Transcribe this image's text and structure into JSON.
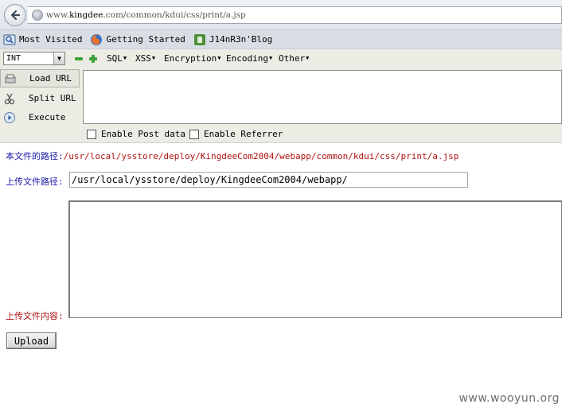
{
  "browser": {
    "url_prefix": "www.",
    "url_host": "kingdee.",
    "url_rest": "com/common/kdui/css/print/a.jsp"
  },
  "bookmarks": [
    {
      "label": "Most Visited",
      "icon": "most-visited-icon"
    },
    {
      "label": "Getting Started",
      "icon": "firefox-icon"
    },
    {
      "label": "J14nR3n'Blog",
      "icon": "evernote-icon"
    }
  ],
  "hackbar": {
    "type_select": "INT",
    "menus": [
      "SQL",
      "XSS",
      "Encryption",
      "Encoding",
      "Other"
    ],
    "load_url": "Load URL",
    "split_url": "Split URL",
    "execute": "Execute",
    "enable_post": "Enable Post data",
    "enable_referrer": "Enable Referrer",
    "url_value": ""
  },
  "page": {
    "path_label": "本文件的路径:",
    "path_value": "/usr/local/ysstore/deploy/KingdeeCom2004/webapp/common/kdui/css/print/a.jsp",
    "upload_path_label": "上传文件路径:",
    "upload_path_value": "/usr/local/ysstore/deploy/KingdeeCom2004/webapp/",
    "upload_content_label": "上传文件内容:",
    "upload_content_value": "",
    "upload_button": "Upload"
  },
  "watermark": "www.wooyun.org"
}
